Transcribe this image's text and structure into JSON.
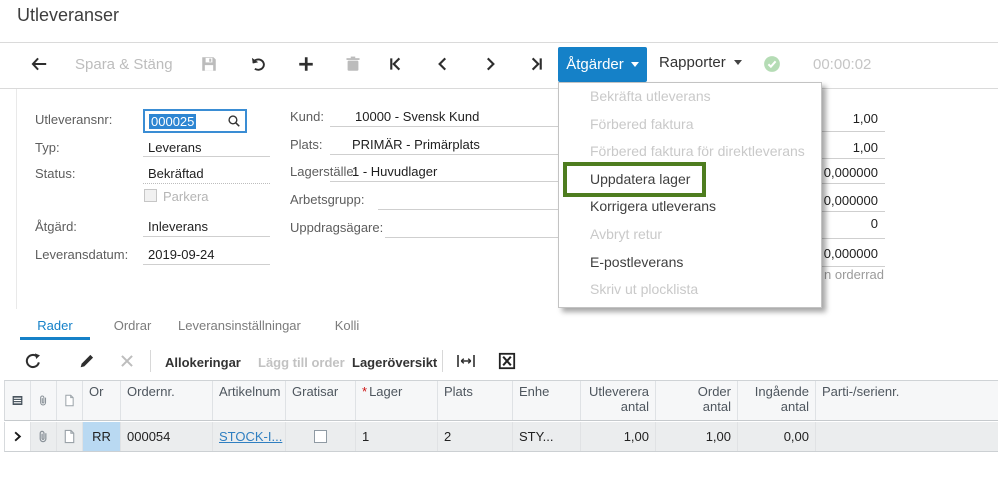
{
  "page": {
    "title": "Utleveranser"
  },
  "toolbar": {
    "save_close": "Spara & Stäng",
    "actions": "Åtgärder",
    "reports": "Rapporter",
    "timer": "00:00:02"
  },
  "actions_menu": {
    "items": [
      {
        "label": "Bekräfta utleverans",
        "enabled": false,
        "annotated": false
      },
      {
        "label": "Förbered faktura",
        "enabled": false,
        "annotated": false
      },
      {
        "label": "Förbered faktura för direktleverans",
        "enabled": false,
        "annotated": false
      },
      {
        "label": "Uppdatera lager",
        "enabled": true,
        "annotated": true
      },
      {
        "label": "Korrigera utleverans",
        "enabled": true,
        "annotated": false
      },
      {
        "label": "Avbryt retur",
        "enabled": false,
        "annotated": false
      },
      {
        "label": "E-postleverans",
        "enabled": true,
        "annotated": false
      },
      {
        "label": "Skriv ut plocklista",
        "enabled": false,
        "annotated": false
      }
    ],
    "annotation_color": "#4e7d1f"
  },
  "summary": {
    "utleveransnr_label": "Utleveransnr:",
    "utleveransnr_value": "000025",
    "typ_label": "Typ:",
    "typ_value": "Leverans",
    "status_label": "Status:",
    "status_value": "Bekräftad",
    "parkera_label": "Parkera",
    "atgard_label": "Åtgärd:",
    "atgard_value": "Inleverans",
    "leveransdatum_label": "Leveransdatum:",
    "leveransdatum_value": "2019-09-24",
    "kund_label": "Kund:",
    "kund_value": "10000 - Svensk Kund",
    "plats_label": "Plats:",
    "plats_value": "PRIMÄR - Primärplats",
    "lagerstalle_label": "Lagerställe:",
    "lagerstalle_value": "1 - Huvudlager",
    "arbetsgrupp_label": "Arbetsgrupp:",
    "arbetsgrupp_value": "",
    "uppdragsagare_label": "Uppdragsägare:",
    "uppdragsagare_value": "",
    "totals": [
      "1,00",
      "1,00",
      "0,000000",
      "0,000000",
      "0",
      "0,000000"
    ],
    "partial_text": "n orderrad"
  },
  "tabs": [
    {
      "label": "Rader",
      "active": true
    },
    {
      "label": "Ordrar",
      "active": false
    },
    {
      "label": "Leveransinställningar",
      "active": false
    },
    {
      "label": "Kolli",
      "active": false
    }
  ],
  "grid_toolbar": {
    "allokeringar": "Allokeringar",
    "lagg_till_order": "Lägg till order",
    "lageroversikt": "Lageröversikt"
  },
  "grid": {
    "headers": {
      "ordertyp": "Or",
      "ordernr": "Ordernr.",
      "artikelnr": "Artikelnum",
      "gratisar": "Gratisar",
      "required_mark": "*",
      "lager": "Lager",
      "plats": "Plats",
      "enhet": "Enhe",
      "utlevererat_line1": "Utleverera",
      "utlevererat_line2": "antal",
      "order_line1": "Order",
      "order_line2": "antal",
      "ingaende_line1": "Ingående",
      "ingaende_line2": "antal",
      "parti": "Parti-/serienr."
    },
    "row": {
      "ordertyp": "RR",
      "ordernr": "000054",
      "artikelnr": "STOCK-I...",
      "gratisar_checked": false,
      "lager": "1",
      "plats": "2",
      "enhet": "STY...",
      "utlevererat": "1,00",
      "orderantal": "1,00",
      "ingaende": "0,00",
      "parti": ""
    }
  },
  "colors": {
    "accent": "#1581c8",
    "annotation": "#4e7d1f",
    "link": "#2f7fc1"
  }
}
